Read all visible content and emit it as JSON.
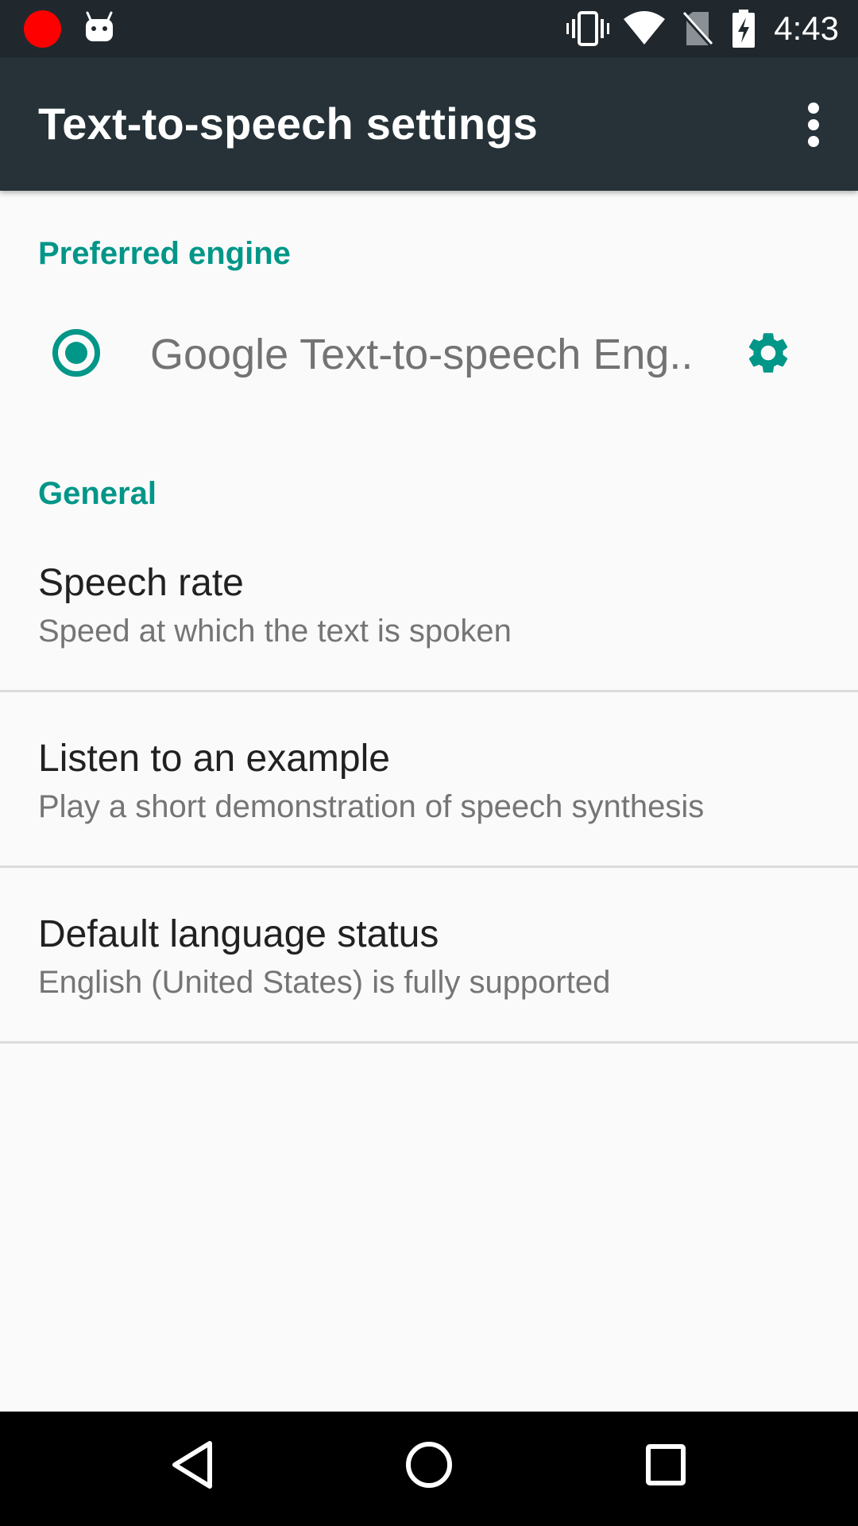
{
  "status_bar": {
    "time": "4:43",
    "icons": [
      "record-indicator-icon",
      "android-icon",
      "vibrate-icon",
      "wifi-icon",
      "no-sim-icon",
      "battery-charging-icon"
    ],
    "record_color": "#ff0000",
    "background_color": "#20282d"
  },
  "app_bar": {
    "title": "Text-to-speech settings",
    "overflow_icon": "more-vert-icon",
    "background_color": "#263238"
  },
  "preferred_engine": {
    "header": "Preferred engine",
    "engine_label": "Google Text-to-speech Eng..",
    "selected": true,
    "settings_icon": "gear-icon",
    "accent_color": "#009688"
  },
  "general": {
    "header": "General",
    "items": [
      {
        "title": "Speech rate",
        "summary": "Speed at which the text is spoken"
      },
      {
        "title": "Listen to an example",
        "summary": "Play a short demonstration of speech synthesis"
      },
      {
        "title": "Default language status",
        "summary": "English (United States) is fully supported"
      }
    ]
  },
  "nav_bar": {
    "buttons": [
      "back-icon",
      "home-icon",
      "recents-icon"
    ]
  }
}
